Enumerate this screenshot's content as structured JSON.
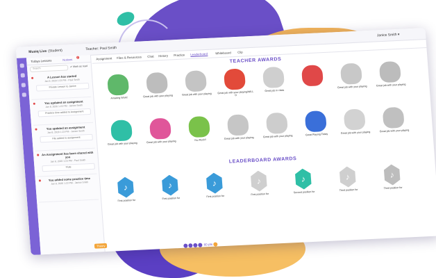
{
  "app": {
    "title": "Musiq Live",
    "role": "(Student)",
    "teacher": "Teacher: Paul Smith",
    "user": "Janice Smith ▾"
  },
  "left_panel": {
    "tab_lessons": "Todays Lessons",
    "tab_notices": "Notices",
    "notice_count": "2",
    "search_placeholder": "Search",
    "mark_all": "✔ Mark as read",
    "feed": [
      {
        "title": "A Lesson has started",
        "meta": "Jan 8, 2020 1:23 PM - Paul Smith",
        "box": "Private Lesson to Janice"
      },
      {
        "title": "You updated an assignment",
        "meta": "Jan 8, 2020 1:23 PM - Janice Smith",
        "box": "Practice time added to Assignment"
      },
      {
        "title": "You updated an assignment",
        "meta": "Jan 8, 2020 1:23 PM - Janice Smith",
        "box": "File added to assignment"
      },
      {
        "title": "An Assignment has been shared with you",
        "meta": "Jan 8, 2020 1:23 PM - Paul Smith",
        "box": "Flute"
      },
      {
        "title": "You added some practice time",
        "meta": "Jan 8, 2020 1:23 PM - Janice Smith",
        "box": ""
      }
    ],
    "bottom_button": "Theory"
  },
  "tabs": [
    "Assignment",
    "Files & Resources",
    "Chat",
    "History",
    "Practice",
    "Leaderboard",
    "Whiteboard",
    "Clip"
  ],
  "active_tab": "Leaderboard",
  "teacher_awards": {
    "heading": "TEACHER AWARDS",
    "row1": [
      "Amazing Work!",
      "Great job with your playing",
      "Great job with your playing",
      "Great job with your playing/WILL D",
      "Great job in class",
      "",
      "Great job with your playing",
      "Great job with your playing"
    ],
    "row2": [
      "Great job with your playing",
      "Great job with your playing",
      "You Rock!!",
      "Great job with your playing",
      "Great job with your playing",
      "Great Playing Today",
      "Great job with your playing",
      "Great job with your playing"
    ]
  },
  "leaderboard_awards": {
    "heading": "LEADERBOARD AWARDS",
    "items": [
      "First position for",
      "First position for",
      "First position for",
      "First position for",
      "Second position for",
      "Third position for",
      "Third position for"
    ]
  },
  "footer": {
    "points": "60 pts"
  },
  "colors": {
    "accent": "#6a4fc7",
    "orange": "#f3a53a",
    "teal": "#2fbfa6",
    "blue": "#3a9bd9"
  }
}
